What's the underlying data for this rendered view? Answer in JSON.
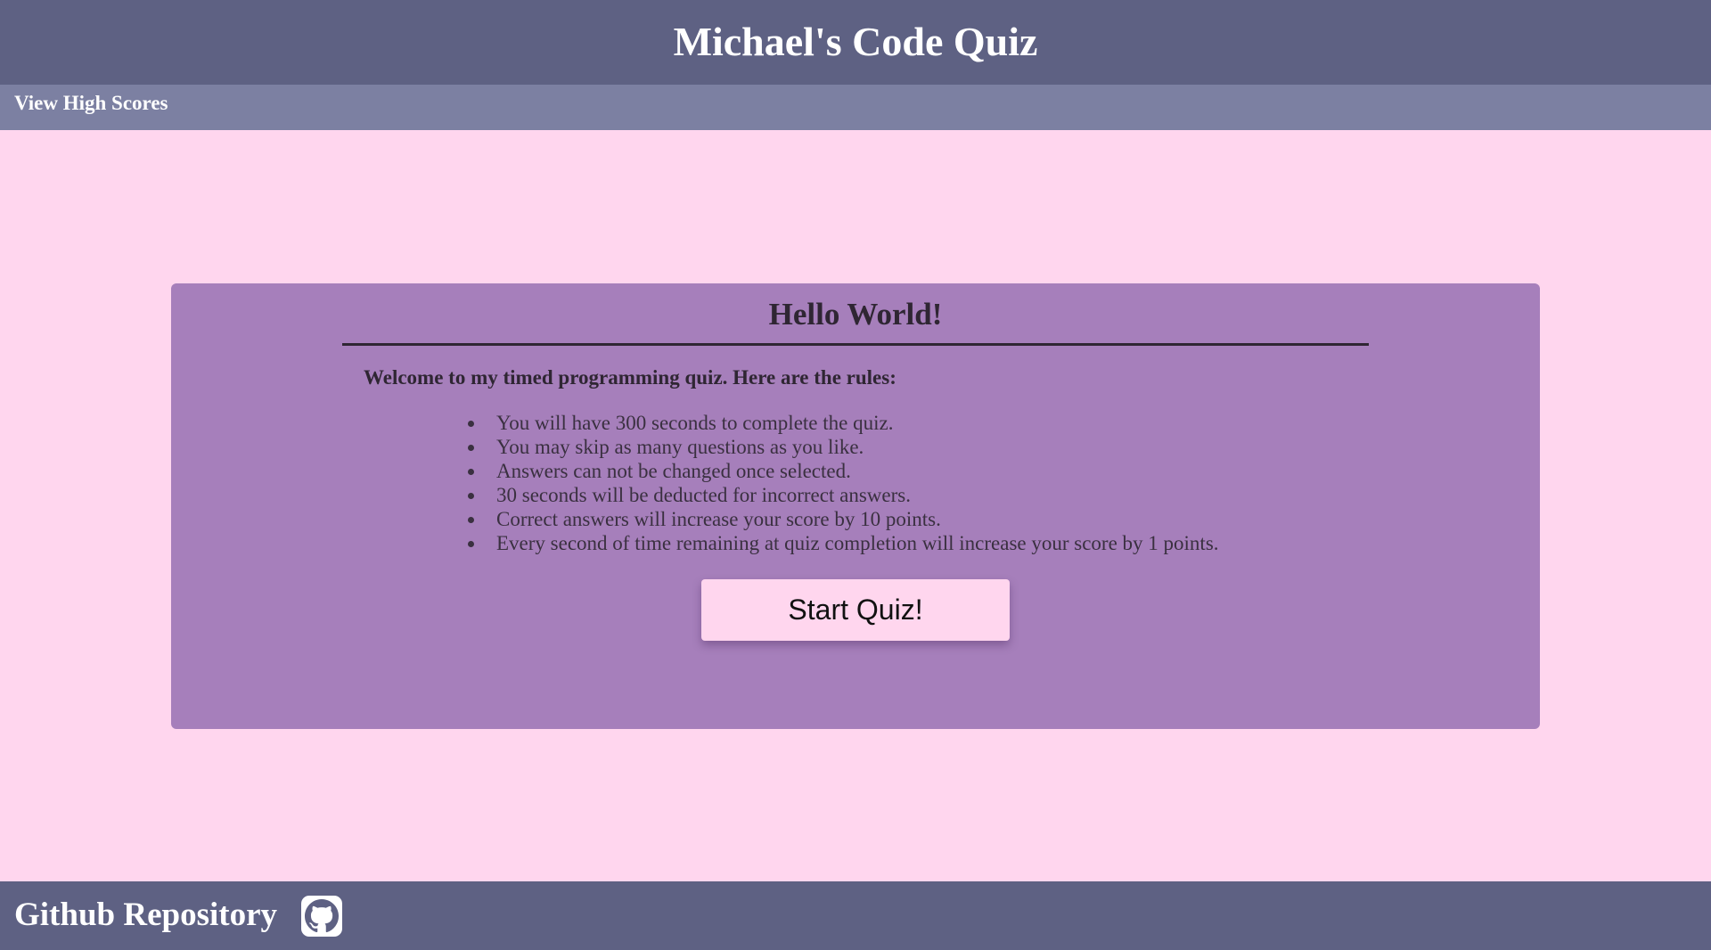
{
  "header": {
    "title": "Michael's Code Quiz"
  },
  "nav": {
    "high_scores_link": "View High Scores"
  },
  "card": {
    "heading": "Hello World!",
    "intro": "Welcome to my timed programming quiz. Here are the rules:",
    "rules": [
      "You will have 300 seconds to complete the quiz.",
      "You may skip as many questions as you like.",
      "Answers can not be changed once selected.",
      "30 seconds will be deducted for incorrect answers.",
      "Correct answers will increase your score by 10 points.",
      "Every second of time remaining at quiz completion will increase your score by 1 points."
    ],
    "start_button": "Start Quiz!"
  },
  "footer": {
    "repo_link": "Github Repository",
    "icon": "github-icon"
  },
  "colors": {
    "page_background": "#ffd6ee",
    "header_background": "#5e6183",
    "nav_background": "#7c80a2",
    "card_background": "#a67fbb",
    "text_dark": "#2f2633"
  }
}
